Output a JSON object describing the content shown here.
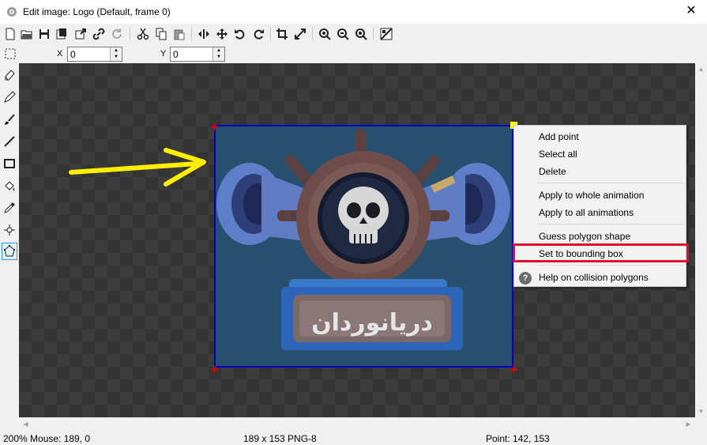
{
  "window": {
    "title": "Edit image: Logo (Default, frame 0)",
    "close_glyph": "✕"
  },
  "toolbar": {
    "icons": [
      "new-icon",
      "open-icon",
      "save-icon",
      "save-as-icon",
      "export-icon",
      "link-icon",
      "refresh-icon",
      "cut-icon",
      "copy-icon",
      "paste-icon",
      "flip-horizontal-icon",
      "move-icon",
      "rotate-left-icon",
      "rotate-right-icon",
      "crop-icon",
      "resize-icon",
      "zoom-in-icon",
      "zoom-out-icon",
      "zoom-reset-icon",
      "image-settings-icon"
    ]
  },
  "coords": {
    "x_label": "X",
    "x_value": "0",
    "y_label": "Y",
    "y_value": "0"
  },
  "tools": [
    "select-rect-icon",
    "eraser-icon",
    "pencil-icon",
    "brush-icon",
    "line-icon",
    "rectangle-icon",
    "fill-icon",
    "eyedropper-icon",
    "origin-icon",
    "polygon-icon"
  ],
  "canvas": {
    "logo_text": "دریانوردان"
  },
  "context_menu": {
    "items": [
      {
        "label": "Add point"
      },
      {
        "label": "Select all"
      },
      {
        "label": "Delete"
      },
      {
        "label": "Apply to whole animation"
      },
      {
        "label": "Apply to all animations"
      },
      {
        "label": "Guess polygon shape"
      },
      {
        "label": "Set to bounding box"
      },
      {
        "label": "Help on collision polygons"
      }
    ],
    "highlighted_item": "Set to bounding box",
    "help_icon_glyph": "?"
  },
  "status": {
    "zoom_mouse": "200%  Mouse: 189, 0",
    "size_format": "189 x 153  PNG-8",
    "point": "Point: 142, 153"
  },
  "colors": {
    "bounding_box": "#0000c8",
    "highlight_box": "#e3102a",
    "arrow": "#ffee00",
    "handles": "#e00000"
  }
}
